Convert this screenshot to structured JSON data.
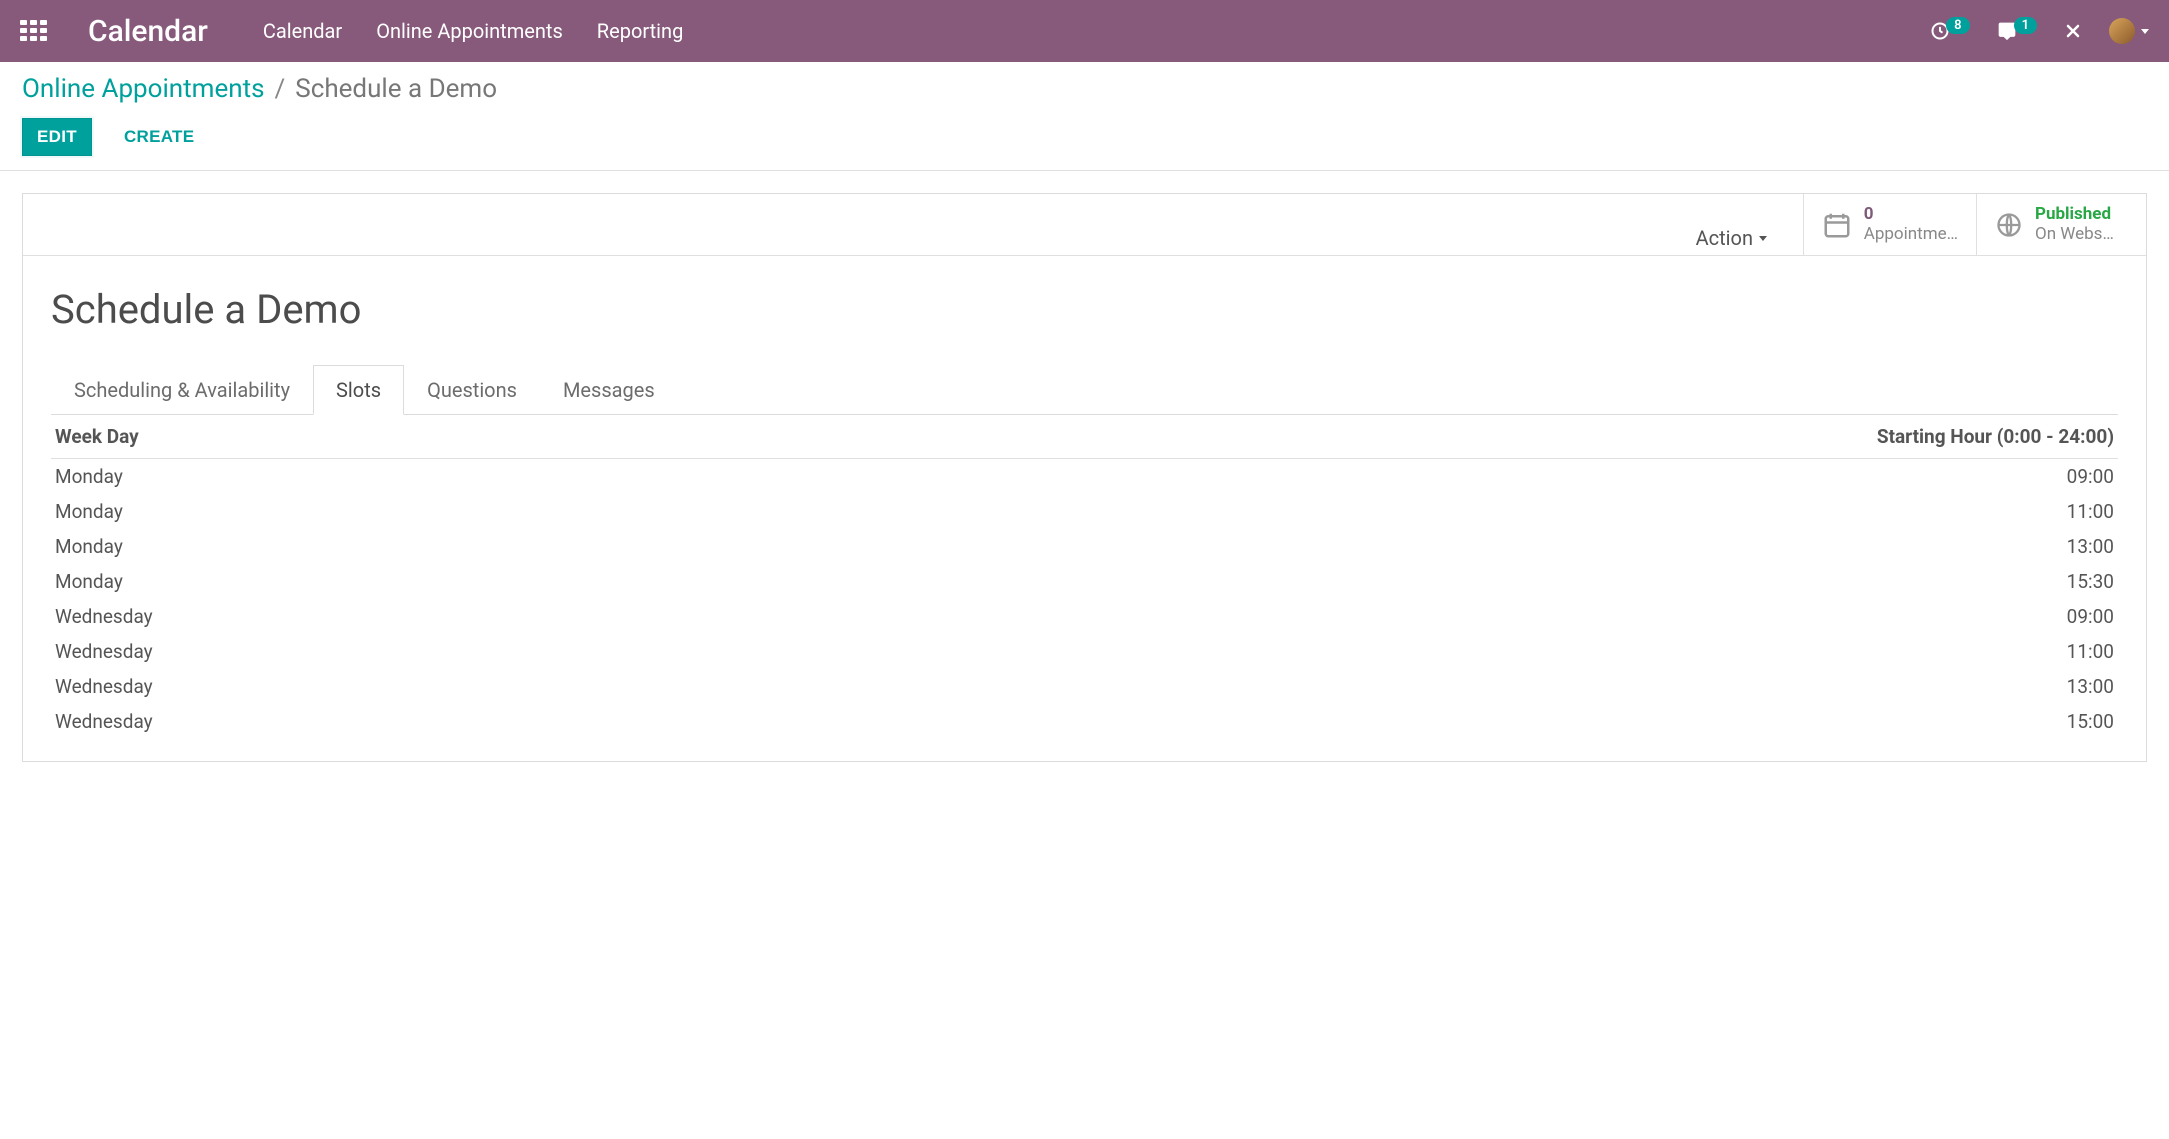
{
  "navbar": {
    "brand": "Calendar",
    "items": [
      "Calendar",
      "Online Appointments",
      "Reporting"
    ],
    "activity_count": "8",
    "chat_count": "1"
  },
  "breadcrumb": {
    "parent": "Online Appointments",
    "separator": "/",
    "current": "Schedule a Demo"
  },
  "buttons": {
    "edit": "EDIT",
    "create": "CREATE",
    "action": "Action"
  },
  "stats": {
    "appointments": {
      "value": "0",
      "label": "Appointme…"
    },
    "published": {
      "value": "Published",
      "label": "On Webs…"
    }
  },
  "record": {
    "title": "Schedule a Demo"
  },
  "tabs": [
    "Scheduling & Availability",
    "Slots",
    "Questions",
    "Messages"
  ],
  "active_tab_index": 1,
  "slots": {
    "headers": {
      "weekday": "Week Day",
      "hour": "Starting Hour (0:00 - 24:00)"
    },
    "rows": [
      {
        "day": "Monday",
        "hour": "09:00"
      },
      {
        "day": "Monday",
        "hour": "11:00"
      },
      {
        "day": "Monday",
        "hour": "13:00"
      },
      {
        "day": "Monday",
        "hour": "15:30"
      },
      {
        "day": "Wednesday",
        "hour": "09:00"
      },
      {
        "day": "Wednesday",
        "hour": "11:00"
      },
      {
        "day": "Wednesday",
        "hour": "13:00"
      },
      {
        "day": "Wednesday",
        "hour": "15:00"
      }
    ]
  }
}
